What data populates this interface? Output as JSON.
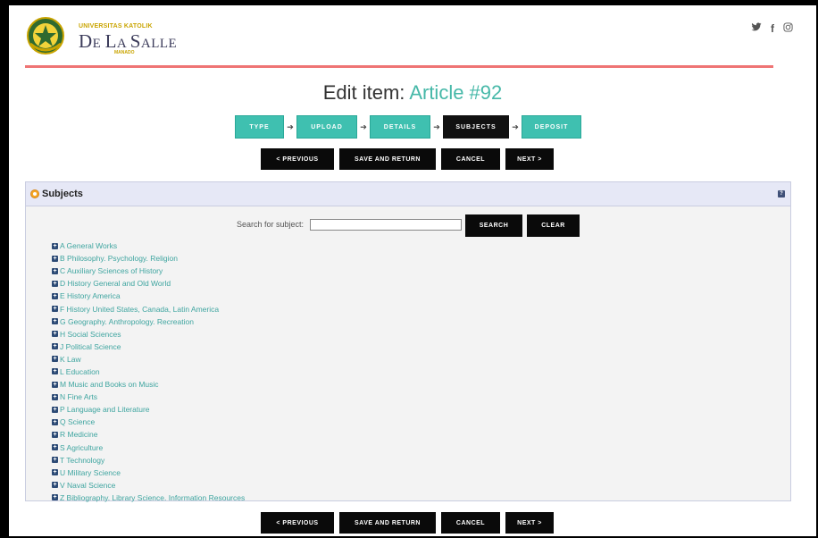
{
  "header": {
    "logo_top": "UNIVERSITAS KATOLIK",
    "logo_main_first": "D",
    "logo_main_small1": "E ",
    "logo_main_second": "L",
    "logo_main_small2": "A ",
    "logo_main_third": "S",
    "logo_main_small3": "ALLE",
    "logo_sub": "MANADO",
    "social": {
      "twitter": "🐦",
      "facebook": "f",
      "instagram": "◎"
    },
    "accent_color": "#ef7474"
  },
  "page": {
    "title_prefix": "Edit item: ",
    "title_highlight": "Article #92"
  },
  "steps": [
    "TYPE",
    "UPLOAD",
    "DETAILS",
    "SUBJECTS",
    "DEPOSIT"
  ],
  "nav": {
    "previous": "< PREVIOUS",
    "save_return": "SAVE AND RETURN",
    "cancel": "CANCEL",
    "next": "NEXT >"
  },
  "panel": {
    "title": "Subjects",
    "help": "?",
    "search_label": "Search for subject:",
    "search_value": "",
    "search_button": "SEARCH",
    "clear_button": "CLEAR"
  },
  "subjects": [
    "A General Works",
    "B Philosophy. Psychology. Religion",
    "C Auxiliary Sciences of History",
    "D History General and Old World",
    "E History America",
    "F History United States, Canada, Latin America",
    "G Geography. Anthropology. Recreation",
    "H Social Sciences",
    "J Political Science",
    "K Law",
    "L Education",
    "M Music and Books on Music",
    "N Fine Arts",
    "P Language and Literature",
    "Q Science",
    "R Medicine",
    "S Agriculture",
    "T Technology",
    "U Military Science",
    "V Naval Science",
    "Z Bibliography. Library Science. Information Resources"
  ]
}
